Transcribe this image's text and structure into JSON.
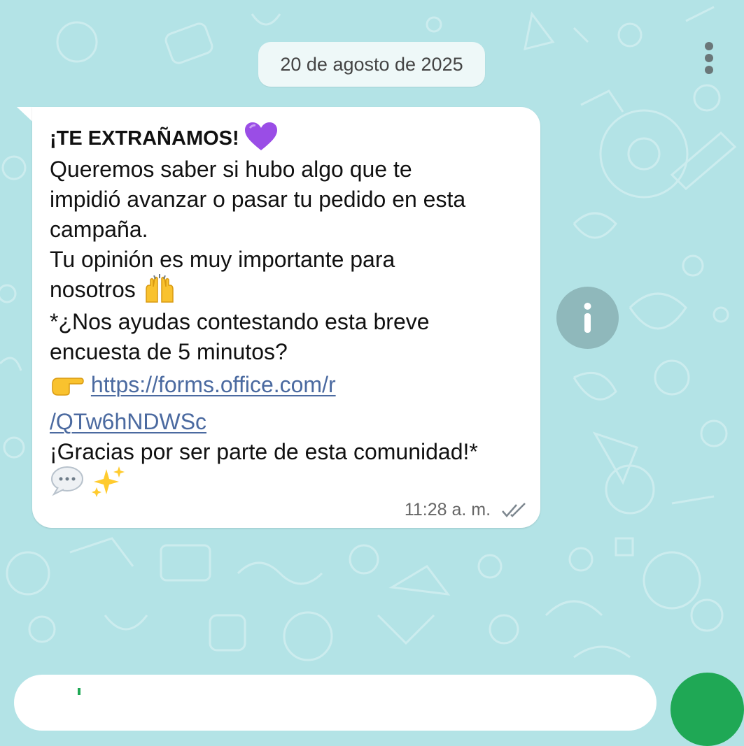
{
  "chat": {
    "date_chip": "20 de agosto de 2025"
  },
  "message": {
    "line1": "¡TE EXTRAÑAMOS!",
    "line2": "Queremos saber si hubo algo que te",
    "line3": "impidió avanzar o pasar tu pedido en esta",
    "line4": "campaña.",
    "line5": "Tu opinión es muy importante para",
    "line6": "nosotros",
    "line7": "*¿Nos ayudas contestando esta breve",
    "line8": "encuesta de 5 minutos?",
    "link_part1": "https://forms.office.com/r",
    "link_part2": "/QTw6hNDWSc",
    "line10": "¡Gracias por ser parte de esta comunidad!*",
    "time": "11:28 a. m.",
    "emojis": [
      "purple-heart",
      "raising-hands",
      "pointing-right",
      "speech-balloon",
      "sparkles"
    ],
    "status": "read"
  },
  "colors": {
    "wallpaper": "#b3e3e6",
    "bubble": "#ffffff",
    "link": "#4b6aa0",
    "send_button": "#1fa855",
    "info_button": "#8fb8bb"
  }
}
